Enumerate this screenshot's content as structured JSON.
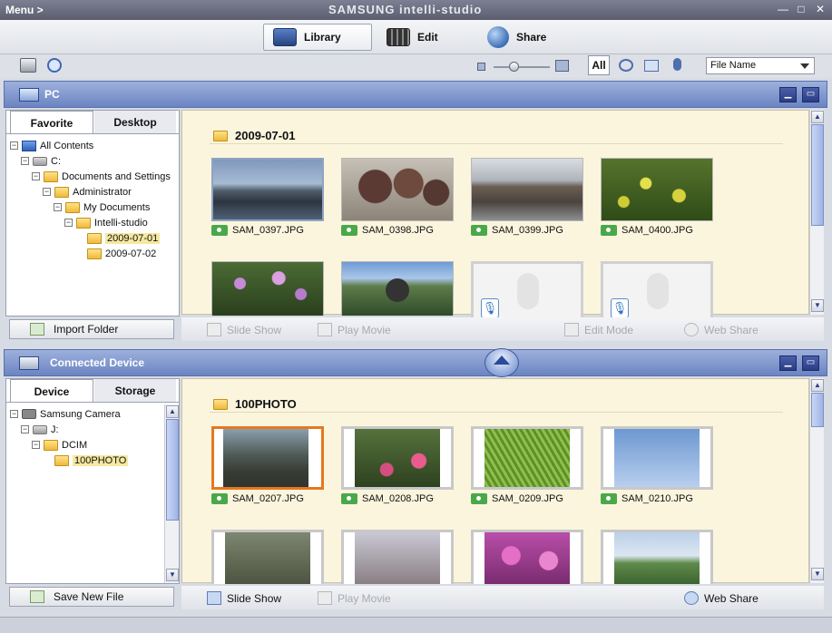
{
  "window": {
    "menu_label": "Menu >",
    "title": "SAMSUNG intelli-studio",
    "minimize_glyph": "—",
    "maximize_glyph": "□",
    "close_glyph": "✕"
  },
  "mode_tabs": [
    {
      "label": "Library",
      "icon": "library-icon",
      "active": true
    },
    {
      "label": "Edit",
      "icon": "edit-film-icon",
      "active": false
    },
    {
      "label": "Share",
      "icon": "share-globe-icon",
      "active": false
    }
  ],
  "toolbar": {
    "print_icon": "printer-icon",
    "zoom_icon": "magnify-icon",
    "filter_all_label": "All",
    "sort_value": "File Name",
    "zoom_level": 0.35
  },
  "pc_panel": {
    "title": "PC",
    "tabs": [
      "Favorite",
      "Desktop"
    ],
    "tree": [
      {
        "label": "All Contents",
        "icon": "computer",
        "level": 0,
        "expander": "−"
      },
      {
        "label": "C:",
        "icon": "drive",
        "level": 1,
        "expander": "−"
      },
      {
        "label": "Documents and Settings",
        "icon": "folder",
        "level": 2,
        "expander": "−"
      },
      {
        "label": "Administrator",
        "icon": "folder",
        "level": 3,
        "expander": "−"
      },
      {
        "label": "My Documents",
        "icon": "folder",
        "level": 4,
        "expander": "−"
      },
      {
        "label": "Intelli-studio",
        "icon": "folder",
        "level": 5,
        "expander": "−"
      },
      {
        "label": "2009-07-01",
        "icon": "folder",
        "level": 6,
        "selected": true
      },
      {
        "label": "2009-07-02",
        "icon": "folder",
        "level": 6
      }
    ],
    "import_button": "Import Folder",
    "folder_name": "2009-07-01",
    "files": [
      "SAM_0397.JPG",
      "SAM_0398.JPG",
      "SAM_0399.JPG",
      "SAM_0400.JPG"
    ],
    "actions": [
      "Slide Show",
      "Play Movie",
      "Edit Mode",
      "Web Share"
    ]
  },
  "device_panel": {
    "title": "Connected Device",
    "tabs": [
      "Device",
      "Storage"
    ],
    "tree": [
      {
        "label": "Samsung Camera",
        "icon": "camera",
        "level": 0,
        "expander": "−"
      },
      {
        "label": "J:",
        "icon": "drive",
        "level": 1,
        "expander": "−"
      },
      {
        "label": "DCIM",
        "icon": "folder",
        "level": 2,
        "expander": "−"
      },
      {
        "label": "100PHOTO",
        "icon": "folder",
        "level": 3,
        "selected": true
      }
    ],
    "save_button": "Save New File",
    "folder_name": "100PHOTO",
    "files": [
      "SAM_0207.JPG",
      "SAM_0208.JPG",
      "SAM_0209.JPG",
      "SAM_0210.JPG"
    ],
    "actions": [
      "Slide Show",
      "Play Movie",
      "Web Share"
    ]
  },
  "colors": {
    "panel_header": "#6b84c2",
    "content_bg": "#fbf5de",
    "selection_border": "#e6781f",
    "photo_badge": "#4aa84a"
  }
}
